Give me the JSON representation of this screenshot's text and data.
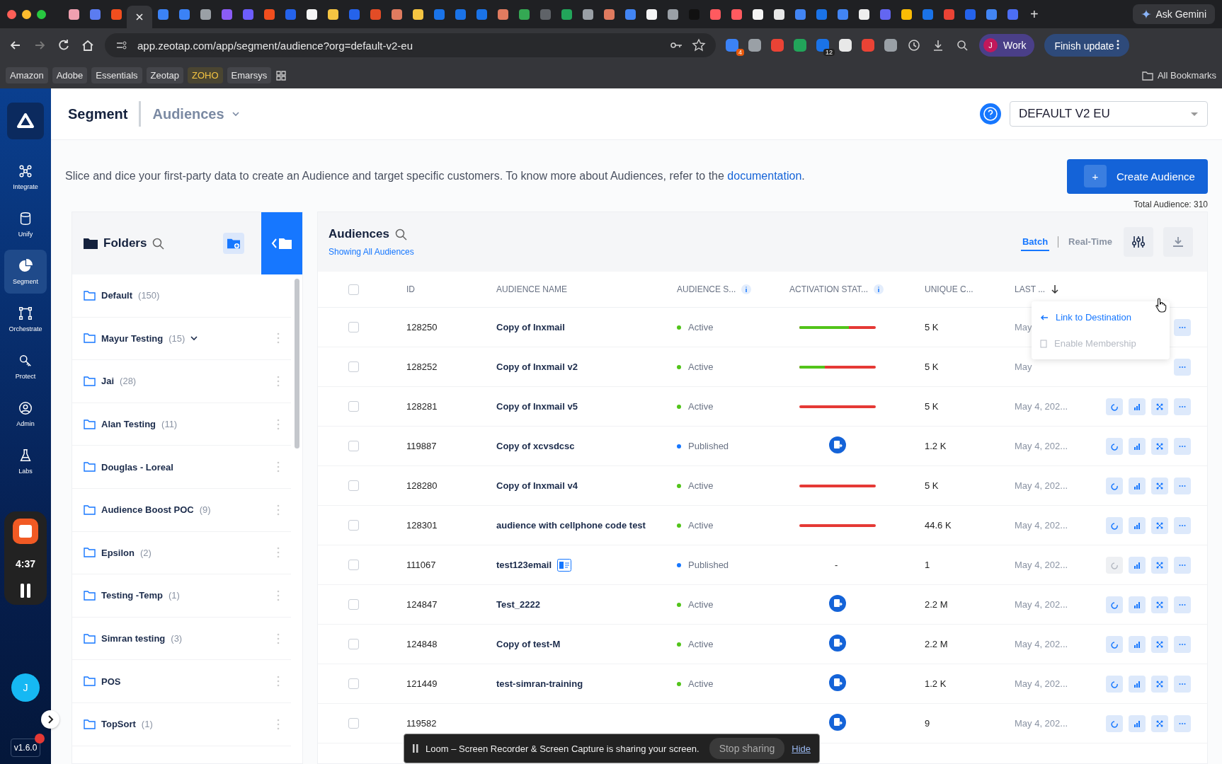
{
  "browser": {
    "tabs": [
      {
        "color": "#f0a0b0",
        "selected": false
      },
      {
        "color": "#5b7cf0",
        "selected": false
      },
      {
        "color": "#f24e1e",
        "selected": false
      },
      {
        "selected": true
      },
      {
        "color": "#3b82f6",
        "selected": false
      },
      {
        "color": "#3b82f6",
        "selected": false
      },
      {
        "color": "#9aa0a6",
        "selected": false
      },
      {
        "color": "#8b5cf6",
        "selected": false
      },
      {
        "color": "#6d5dfc",
        "selected": false
      },
      {
        "color": "#f24e1e",
        "selected": false
      },
      {
        "color": "#2563eb",
        "selected": false
      },
      {
        "color": "#f5f5f5",
        "selected": false
      },
      {
        "color": "#f5c542",
        "selected": false
      },
      {
        "color": "#2563eb",
        "selected": false
      },
      {
        "color": "#e34c26",
        "selected": false
      },
      {
        "color": "#e07b5f",
        "selected": false
      },
      {
        "color": "#f5c542",
        "selected": false
      },
      {
        "color": "#1a73e8",
        "selected": false
      },
      {
        "color": "#1a73e8",
        "selected": false
      },
      {
        "color": "#1a73e8",
        "selected": false
      },
      {
        "color": "#e07b5f",
        "selected": false
      },
      {
        "color": "#34a853",
        "selected": false
      },
      {
        "color": "#5f6368",
        "selected": false
      },
      {
        "color": "#22a55a",
        "selected": false
      },
      {
        "color": "#9aa0a6",
        "selected": false
      },
      {
        "color": "#e07b5f",
        "selected": false
      },
      {
        "color": "#4285f4",
        "selected": false
      },
      {
        "color": "#f5f5f5",
        "selected": false
      },
      {
        "color": "#9aa0a6",
        "selected": false
      },
      {
        "color": "#111111",
        "selected": false
      },
      {
        "color": "#ff5a5f",
        "selected": false
      },
      {
        "color": "#ff5a5f",
        "selected": false
      },
      {
        "color": "#f4f4f4",
        "selected": false
      },
      {
        "color": "#e8e8e8",
        "selected": false
      },
      {
        "color": "#4285f4",
        "selected": false
      },
      {
        "color": "#1a73e8",
        "selected": false
      },
      {
        "color": "#4285f4",
        "selected": false
      },
      {
        "color": "#eeeeee",
        "selected": false
      },
      {
        "color": "#6366f1",
        "selected": false
      },
      {
        "color": "#fbbc05",
        "selected": false
      },
      {
        "color": "#1a73e8",
        "selected": false
      },
      {
        "color": "#ea4335",
        "selected": false
      },
      {
        "color": "#2563eb",
        "selected": false
      },
      {
        "color": "#4285f4",
        "selected": false
      },
      {
        "color": "#4c6ef5",
        "selected": false
      }
    ],
    "new_tab": "+",
    "gemini": "Ask Gemini",
    "url": "app.zeotap.com/app/segment/audience?org=default-v2-eu",
    "extensions": [
      {
        "color": "#3b82f6",
        "badge": "4"
      },
      {
        "color": "#9aa0a6"
      },
      {
        "color": "#ea4335"
      },
      {
        "color": "#22a55a"
      },
      {
        "color": "#1a73e8",
        "badge": "12"
      },
      {
        "color": "#e8e8e8"
      },
      {
        "color": "#ea4335"
      },
      {
        "color": "#9aa0a6"
      }
    ],
    "profile": {
      "initial": "J",
      "label": "Work"
    },
    "update": "Finish update",
    "bookmarks": [
      {
        "label": "Amazon",
        "highlight": false
      },
      {
        "label": "Adobe",
        "highlight": false
      },
      {
        "label": "Essentials",
        "highlight": false
      },
      {
        "label": "Zeotap",
        "highlight": false
      },
      {
        "label": "ZOHO",
        "highlight": true
      },
      {
        "label": "Emarsys",
        "highlight": false
      }
    ],
    "all_bookmarks": "All Bookmarks"
  },
  "nav": {
    "items": [
      {
        "kind": "integrate",
        "label": "Integrate",
        "selected": false
      },
      {
        "kind": "unify",
        "label": "Unify",
        "selected": false
      },
      {
        "kind": "segment",
        "label": "Segment",
        "selected": true
      },
      {
        "kind": "orchestrate",
        "label": "Orchestrate",
        "selected": false
      },
      {
        "kind": "protect",
        "label": "Protect",
        "selected": false
      },
      {
        "kind": "admin",
        "label": "Admin",
        "selected": false
      },
      {
        "kind": "labs",
        "label": "Labs",
        "selected": false
      }
    ],
    "recorder": {
      "time": "4:37"
    },
    "avatar": "J",
    "version": "v1.6.0"
  },
  "header": {
    "title": "Segment",
    "section": "Audiences",
    "org": "DEFAULT V2 EU"
  },
  "intro": {
    "text": "Slice and dice your first-party data to create an Audience and target specific customers. To know more about Audiences, refer to the",
    "link": "documentation",
    "end": "."
  },
  "create_button": "Create Audience",
  "create_plus": "+",
  "total": "Total Audience: 310",
  "folders": {
    "title": "Folders",
    "items": [
      {
        "name": "Default",
        "count": "(150)",
        "expandable": false,
        "menu": false
      },
      {
        "name": "Mayur Testing",
        "count": "(15)",
        "expandable": true,
        "menu": true
      },
      {
        "name": "Jai",
        "count": "(28)",
        "expandable": false,
        "menu": true
      },
      {
        "name": "Alan Testing",
        "count": "(11)",
        "expandable": false,
        "menu": true
      },
      {
        "name": "Douglas - Loreal",
        "expandable": false,
        "menu": true
      },
      {
        "name": "Audience Boost POC",
        "count": "(9)",
        "expandable": false,
        "menu": true
      },
      {
        "name": "Epsilon",
        "count": "(2)",
        "expandable": false,
        "menu": true
      },
      {
        "name": "Testing -Temp",
        "count": "(1)",
        "expandable": false,
        "menu": true
      },
      {
        "name": "Simran testing",
        "count": "(3)",
        "expandable": false,
        "menu": true
      },
      {
        "name": "POS",
        "expandable": false,
        "menu": true
      },
      {
        "name": "TopSort",
        "count": "(1)",
        "expandable": false,
        "menu": true
      }
    ]
  },
  "audiences": {
    "title": "Audiences",
    "subtitle": "Showing All Audiences",
    "modes": [
      {
        "label": "Batch",
        "selected": true
      },
      {
        "label": "Real-Time",
        "selected": false
      }
    ],
    "select_all": {
      "checked": false
    },
    "columns": [
      {
        "label": "ID",
        "info": false,
        "sorted": false
      },
      {
        "label": "AUDIENCE NAME",
        "info": false,
        "sorted": false
      },
      {
        "label": "AUDIENCE S...",
        "info": true,
        "sorted": false
      },
      {
        "label": "ACTIVATION STAT...",
        "info": true,
        "sorted": false
      },
      {
        "label": "UNIQUE C...",
        "info": false,
        "sorted": false
      },
      {
        "label": "LAST ...",
        "info": false,
        "sorted": true
      }
    ],
    "rows": [
      {
        "checked": false,
        "id": "128250",
        "name": "Copy of Inxmail",
        "status": "Active",
        "color": "#52c41a",
        "activation": {
          "kind": "bar",
          "level": 0.65
        },
        "unique": "5 K",
        "date": "May",
        "actions": false
      },
      {
        "checked": false,
        "id": "128252",
        "name": "Copy of Inxmail v2",
        "status": "Active",
        "color": "#52c41a",
        "activation": {
          "kind": "bar",
          "level": 0.33
        },
        "unique": "5 K",
        "date": "May",
        "actions": false
      },
      {
        "checked": false,
        "id": "128281",
        "name": "Copy of Inxmail v5",
        "status": "Active",
        "color": "#52c41a",
        "activation": {
          "kind": "bar",
          "level": 0
        },
        "unique": "5 K",
        "date": "May 4, 202...",
        "actions": true,
        "refresh_disabled": false
      },
      {
        "checked": false,
        "id": "119887",
        "name": "Copy of xcvsdcsc",
        "status": "Published",
        "color": "#1677ff",
        "activation": {
          "kind": "icon"
        },
        "unique": "1.2 K",
        "date": "May 4, 202...",
        "actions": true,
        "refresh_disabled": false
      },
      {
        "checked": false,
        "id": "128280",
        "name": "Copy of Inxmail v4",
        "status": "Active",
        "color": "#52c41a",
        "activation": {
          "kind": "bar",
          "level": 0
        },
        "unique": "5 K",
        "date": "May 4, 202...",
        "actions": true,
        "refresh_disabled": false
      },
      {
        "checked": false,
        "id": "128301",
        "name": "audience with cellphone code test",
        "status": "Active",
        "color": "#52c41a",
        "activation": {
          "kind": "bar",
          "level": 0
        },
        "unique": "44.6 K",
        "date": "May 4, 202...",
        "actions": true,
        "refresh_disabled": false
      },
      {
        "checked": false,
        "id": "111067",
        "name": "test123email",
        "tag": true,
        "status": "Published",
        "color": "#1677ff",
        "activation": {
          "kind": "dash",
          "text": "-"
        },
        "unique": "1",
        "date": "May 4, 202...",
        "actions": true,
        "refresh_disabled": true
      },
      {
        "checked": false,
        "id": "124847",
        "name": "Test_2222",
        "status": "Active",
        "color": "#52c41a",
        "activation": {
          "kind": "icon"
        },
        "unique": "2.2 M",
        "date": "May 4, 202...",
        "actions": true,
        "refresh_disabled": false
      },
      {
        "checked": false,
        "id": "124848",
        "name": "Copy of test-M",
        "status": "Active",
        "color": "#52c41a",
        "activation": {
          "kind": "icon"
        },
        "unique": "2.2 M",
        "date": "May 4, 202...",
        "actions": true,
        "refresh_disabled": false
      },
      {
        "checked": false,
        "id": "121449",
        "name": "test-simran-training",
        "status": "Active",
        "color": "#52c41a",
        "activation": {
          "kind": "icon"
        },
        "unique": "1.2 K",
        "date": "May 4, 202...",
        "actions": true,
        "refresh_disabled": false
      },
      {
        "checked": false,
        "id": "119582",
        "activation": {
          "kind": "icon"
        },
        "unique": "9",
        "date": "May 4, 202...",
        "actions": true,
        "refresh_disabled": false
      }
    ],
    "menu": [
      {
        "label": "Link to Destination",
        "disabled": false
      },
      {
        "label": "Enable Membership",
        "disabled": true
      }
    ]
  },
  "share_bar": {
    "text": "Loom – Screen Recorder & Screen Capture is sharing your screen.",
    "stop": "Stop sharing",
    "hide": "Hide"
  }
}
